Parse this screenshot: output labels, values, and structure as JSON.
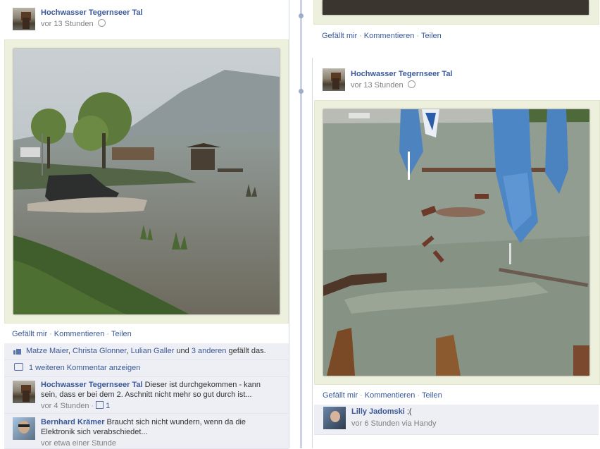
{
  "left_post": {
    "page_name": "Hochwasser Tegernseer Tal",
    "time": "vor 13 Stunden",
    "actions": {
      "like": "Gefällt mir",
      "comment": "Kommentieren",
      "share": "Teilen"
    },
    "likes": {
      "names": [
        "Matze Maier",
        "Christa Glonner",
        "Lulian Galler"
      ],
      "and": "und",
      "others": "3 anderen",
      "suffix": "gefällt das."
    },
    "more_comments": "1 weiteren Kommentar anzeigen",
    "comments": [
      {
        "name": "Hochwasser Tegernseer Tal",
        "text": "Dieser ist durchgekommen - kann sein, dass er bei dem 2. Aschnitt nicht mehr so gut durch ist...",
        "time": "vor 4 Stunden",
        "likes": "1"
      },
      {
        "name": "Bernhard Krämer",
        "text": "Braucht sich nicht wundern, wenn da die Elektronik sich verabschiedet...",
        "time": "vor etwa einer Stunde"
      }
    ]
  },
  "right_top": {
    "actions": {
      "like": "Gefällt mir",
      "comment": "Kommentieren",
      "share": "Teilen"
    }
  },
  "right_post": {
    "page_name": "Hochwasser Tegernseer Tal",
    "time": "vor 13 Stunden",
    "actions": {
      "like": "Gefällt mir",
      "comment": "Kommentieren",
      "share": "Teilen"
    },
    "comment": {
      "name": "Lilly Jadomski",
      "text": ";(",
      "time": "vor 6 Stunden via Handy"
    }
  },
  "icons": [
    "globe-icon",
    "like-icon",
    "comment-icon",
    "thumbs-up-icon"
  ],
  "colors": {
    "link": "#3b5998",
    "ufi_bg": "#edeff4",
    "timeline": "#cbd3e5",
    "photo_frame": "#eef0de"
  }
}
